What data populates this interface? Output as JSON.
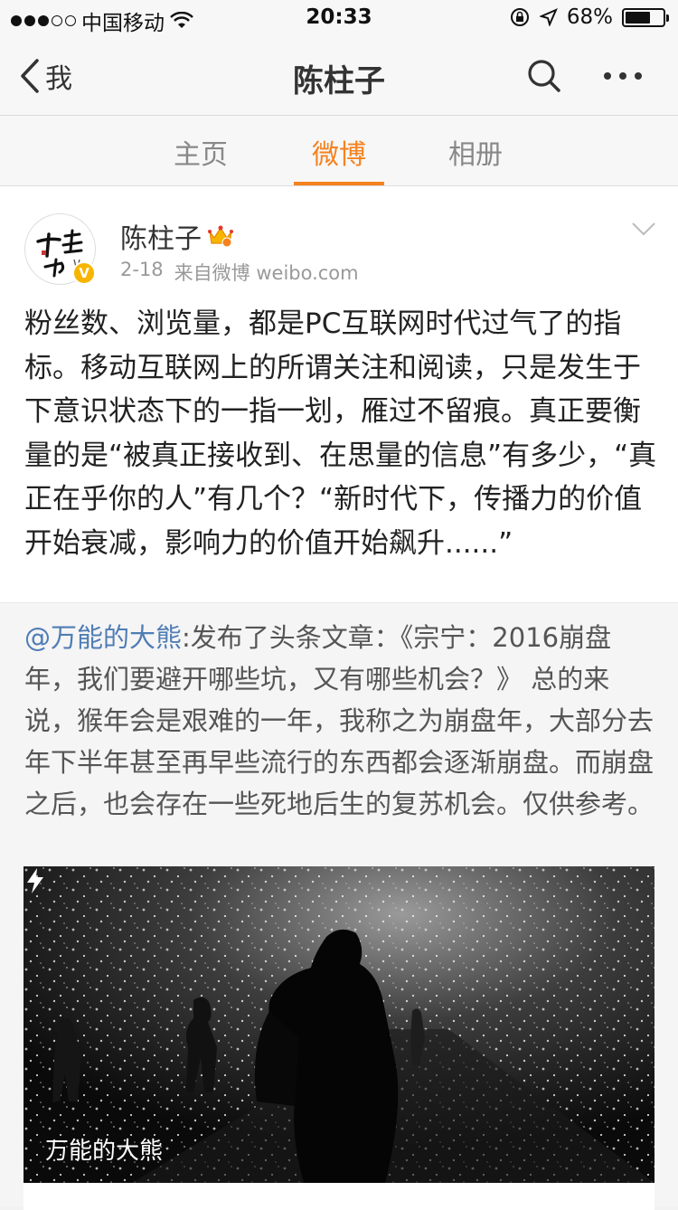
{
  "status_bar": {
    "carrier": "中国移动",
    "time": "20:33",
    "battery_percent": "68%",
    "battery_level": 0.68
  },
  "navbar": {
    "back_label": "我",
    "title": "陈柱子"
  },
  "tabs": [
    {
      "label": "主页",
      "active": false
    },
    {
      "label": "微博",
      "active": true
    },
    {
      "label": "相册",
      "active": false
    }
  ],
  "post": {
    "author": "陈柱子",
    "date": "2-18",
    "source": "来自微博 weibo.com",
    "text": "粉丝数、浏览量，都是PC互联网时代过气了的指标。移动互联网上的所谓关注和阅读，只是发生于下意识状态下的一指一划，雁过不留痕。真正要衡量的是“被真正接收到、在思量的信息”有多少，“真正在乎你的人”有几个？“新时代下，传播力的价值开始衰减，影响力的价值开始飙升......”"
  },
  "repost": {
    "mention": "@万能的大熊",
    "text": ":发布了头条文章：《宗宁：2016崩盘年，我们要避开哪些坑，又有哪些机会？》 总的来说，猴年会是艰难的一年，我称之为崩盘年，大部分去年下半年甚至再早些流行的东西都会逐渐崩盘。而崩盘之后，也会存在一些死地后生的复苏机会。仅供参考。",
    "media_caption": "万能的大熊"
  },
  "colors": {
    "accent": "#f5821f",
    "mention": "#4f7db5",
    "verified": "#f7b500"
  },
  "icons": [
    "back-chevron-icon",
    "search-icon",
    "more-icon",
    "chevron-down-icon",
    "crown-badge-icon",
    "verified-badge-icon",
    "bolt-icon",
    "wifi-icon",
    "lock-rotation-icon",
    "location-icon",
    "battery-icon"
  ]
}
